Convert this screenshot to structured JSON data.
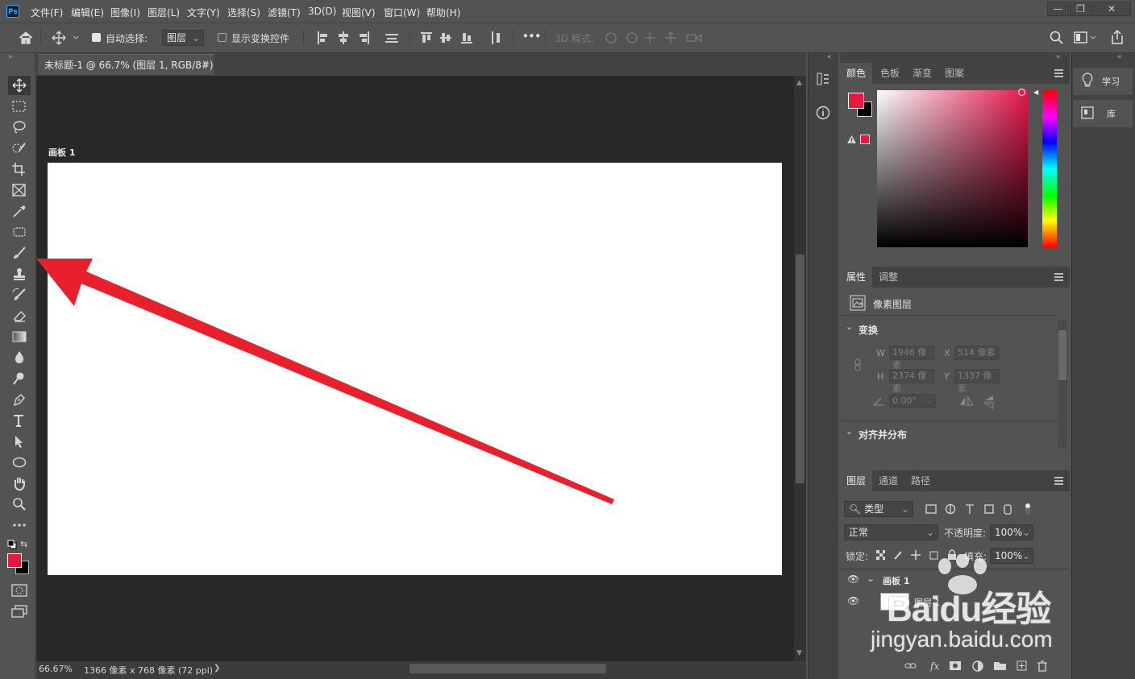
{
  "app": {
    "logo": "Ps"
  },
  "menu": [
    "文件(F)",
    "编辑(E)",
    "图像(I)",
    "图层(L)",
    "文字(Y)",
    "选择(S)",
    "滤镜(T)",
    "3D(D)",
    "视图(V)",
    "窗口(W)",
    "帮助(H)"
  ],
  "window_controls": {
    "minimize": "—",
    "restore": "❐",
    "close": "✕"
  },
  "options": {
    "auto_select_label": "自动选择:",
    "auto_select_checked": true,
    "auto_select_target": "图层",
    "show_transform_label": "显示变换控件",
    "show_transform_checked": false,
    "more": "•••",
    "mode_3d_label": "3D 模式:"
  },
  "document": {
    "tab_title": "未标题-1 @ 66.7% (图层 1, RGB/8#)",
    "tab_close": "×",
    "artboard_label": "画板 1"
  },
  "status": {
    "zoom": "66.67%",
    "doc_info": "1366 像素 x 768 像素 (72 ppi)",
    "arrow": "❯"
  },
  "color_panel": {
    "tabs": [
      "颜色",
      "色板",
      "渐变",
      "图案"
    ],
    "active_tab": 0,
    "foreground": "#e8173f",
    "background": "#000000",
    "hue_color": "#e8174d"
  },
  "properties_panel": {
    "tabs": [
      "属性",
      "调整"
    ],
    "active_tab": 0,
    "layer_type": "像素图层",
    "transform_title": "变换",
    "w_label": "W",
    "w_value": "1946 像素",
    "x_label": "X",
    "x_value": "514 像素",
    "h_label": "H",
    "h_value": "2374 像素",
    "y_label": "Y",
    "y_value": "1337 像素",
    "angle_value": "0.00°",
    "align_title": "对齐并分布"
  },
  "layers_panel": {
    "tabs": [
      "图层",
      "通道",
      "路径"
    ],
    "active_tab": 0,
    "filter_kind": "类型",
    "blend_mode": "正常",
    "opacity_label": "不透明度:",
    "opacity_value": "100%",
    "lock_label": "锁定:",
    "fill_label": "填充:",
    "fill_value": "100%",
    "layers": [
      {
        "name": "画板 1",
        "type": "artboard"
      },
      {
        "name": "图层 1",
        "type": "pixel"
      }
    ]
  },
  "far_right": {
    "learn": "学习",
    "library": "库"
  },
  "watermark": {
    "brand": "Baidu经验",
    "url": "jingyan.baidu.com"
  },
  "annotation": {
    "arrow_color": "#e8202b"
  }
}
